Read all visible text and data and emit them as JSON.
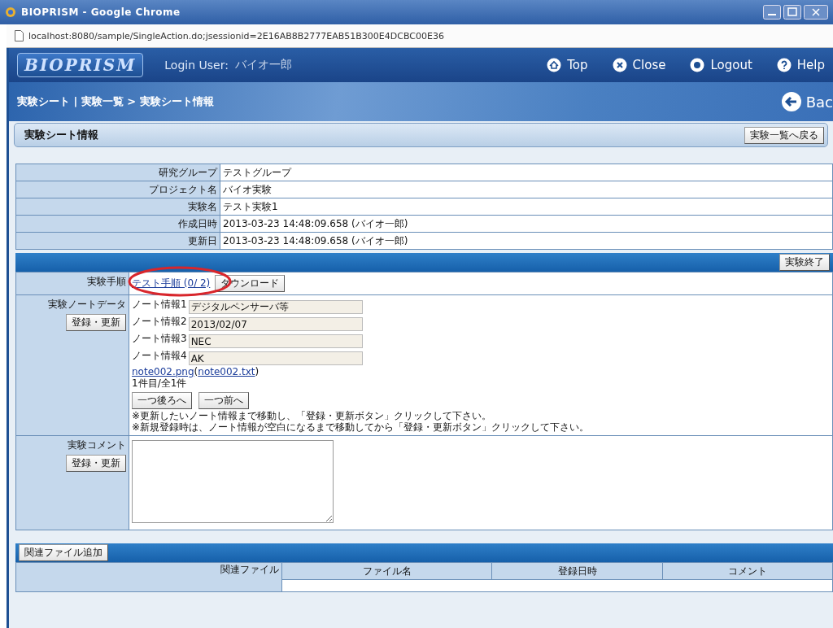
{
  "window": {
    "title": "BIOPRISM - Google Chrome"
  },
  "address_bar": {
    "url": "localhost:8080/sample/SingleAction.do;jsessionid=2E16AB8B2777EAB51B300E4DCBC00E36"
  },
  "header": {
    "logo": "BIOPRISM",
    "login_label": "Login User:",
    "login_user": "バイオ一郎",
    "nav": [
      {
        "kind": "home",
        "label": "Top"
      },
      {
        "kind": "close",
        "label": "Close"
      },
      {
        "kind": "logout",
        "label": "Logout"
      },
      {
        "kind": "help",
        "label": "Help"
      }
    ]
  },
  "breadcrumb": {
    "path": "実験シート | 実験一覧 > 実験シート情報",
    "back": "Bac"
  },
  "section": {
    "title": "実験シート情報",
    "back_button": "実験一覧へ戻る"
  },
  "info": [
    {
      "label": "研究グループ",
      "value": "テストグループ"
    },
    {
      "label": "プロジェクト名",
      "value": "バイオ実験"
    },
    {
      "label": "実験名",
      "value": "テスト実験1"
    },
    {
      "label": "作成日時",
      "value": "2013-03-23 14:48:09.658 (バイオ一郎)"
    },
    {
      "label": "更新日",
      "value": "2013-03-23 14:48:09.658 (バイオ一郎)"
    }
  ],
  "end_button": "実験終了",
  "procedure": {
    "label": "実験手順",
    "link": "テスト手順 (0/ 2)",
    "annotated": true,
    "download_button": "ダウンロード"
  },
  "notes": {
    "label": "実験ノートデータ",
    "button": "登録・更新",
    "fields": [
      {
        "label": "ノート情報1",
        "value": "デジタルペンサーバ等"
      },
      {
        "label": "ノート情報2",
        "value": "2013/02/07"
      },
      {
        "label": "ノート情報3",
        "value": "NEC"
      },
      {
        "label": "ノート情報4",
        "value": "AK"
      }
    ],
    "file_links": {
      "image": "note002.png",
      "open": "(",
      "text": "note002.txt",
      "close": ")"
    },
    "count": "1件目/全1件",
    "nav_buttons": [
      "一つ後ろへ",
      "一つ前へ"
    ],
    "hints": [
      "※更新したいノート情報まで移動し、「登録・更新ボタン」クリックして下さい。",
      "※新規登録時は、ノート情報が空白になるまで移動してから「登録・更新ボタン」クリックして下さい。"
    ]
  },
  "comment": {
    "label": "実験コメント",
    "button": "登録・更新"
  },
  "related": {
    "add_button": "関連ファイル追加",
    "label": "関連ファイル",
    "columns": [
      "ファイル名",
      "登録日時",
      "コメント"
    ]
  }
}
